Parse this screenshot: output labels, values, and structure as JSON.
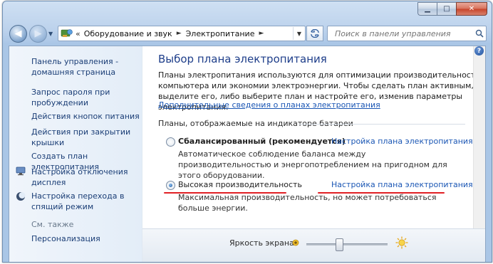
{
  "window": {
    "minimize_glyph": "▁",
    "maximize_glyph": "□",
    "close_glyph": "✕"
  },
  "navigation": {
    "back_glyph": "◀",
    "forward_glyph": "▶",
    "address": {
      "overflow_glyph": "«",
      "breadcrumbs": [
        "Оборудование и звук",
        "Электропитание"
      ],
      "separator_glyph": "►"
    },
    "search": {
      "placeholder": "Поиск в панели управления"
    }
  },
  "sidebar": {
    "home_link": "Панель управления -\nдомашняя страница",
    "links": [
      "Запрос пароля при\nпробуждении",
      "Действия кнопок питания",
      "Действия при закрытии\nкрышки",
      "Создать план электропитания",
      "Настройка отключения\nдисплея",
      "Настройка перехода в\nспящий режим"
    ],
    "see_also_label": "См. также",
    "see_also_links": [
      "Персонализация"
    ]
  },
  "main": {
    "title": "Выбор плана электропитания",
    "description": "Планы электропитания используются для оптимизации производительности компьютера или экономии электроэнергии. Чтобы сделать план активным, выделите его, либо выберите план и настройте его, изменив параметры электропитания.",
    "more_link": "Дополнительные сведения о планах электропитания",
    "section_label": "Планы, отображаемые на индикаторе батареи",
    "plans": [
      {
        "name": "Сбалансированный (рекомендуется)",
        "selected": false,
        "settings_link": "Настройка плана электропитания",
        "description": "Автоматическое соблюдение баланса между производительностью и энергопотреблением на пригодном для этого оборудовании."
      },
      {
        "name": "Высокая производительность",
        "selected": true,
        "settings_link": "Настройка плана электропитания",
        "description": "Максимальная производительность, но может потребоваться больше энергии."
      }
    ],
    "help_glyph": "?"
  },
  "footer": {
    "brightness_label": "Яркость экрана:",
    "brightness_level": 0.4
  },
  "colors": {
    "link": "#1a56b4",
    "title": "#1e3e8a",
    "highlight_underline": "#e12024"
  }
}
